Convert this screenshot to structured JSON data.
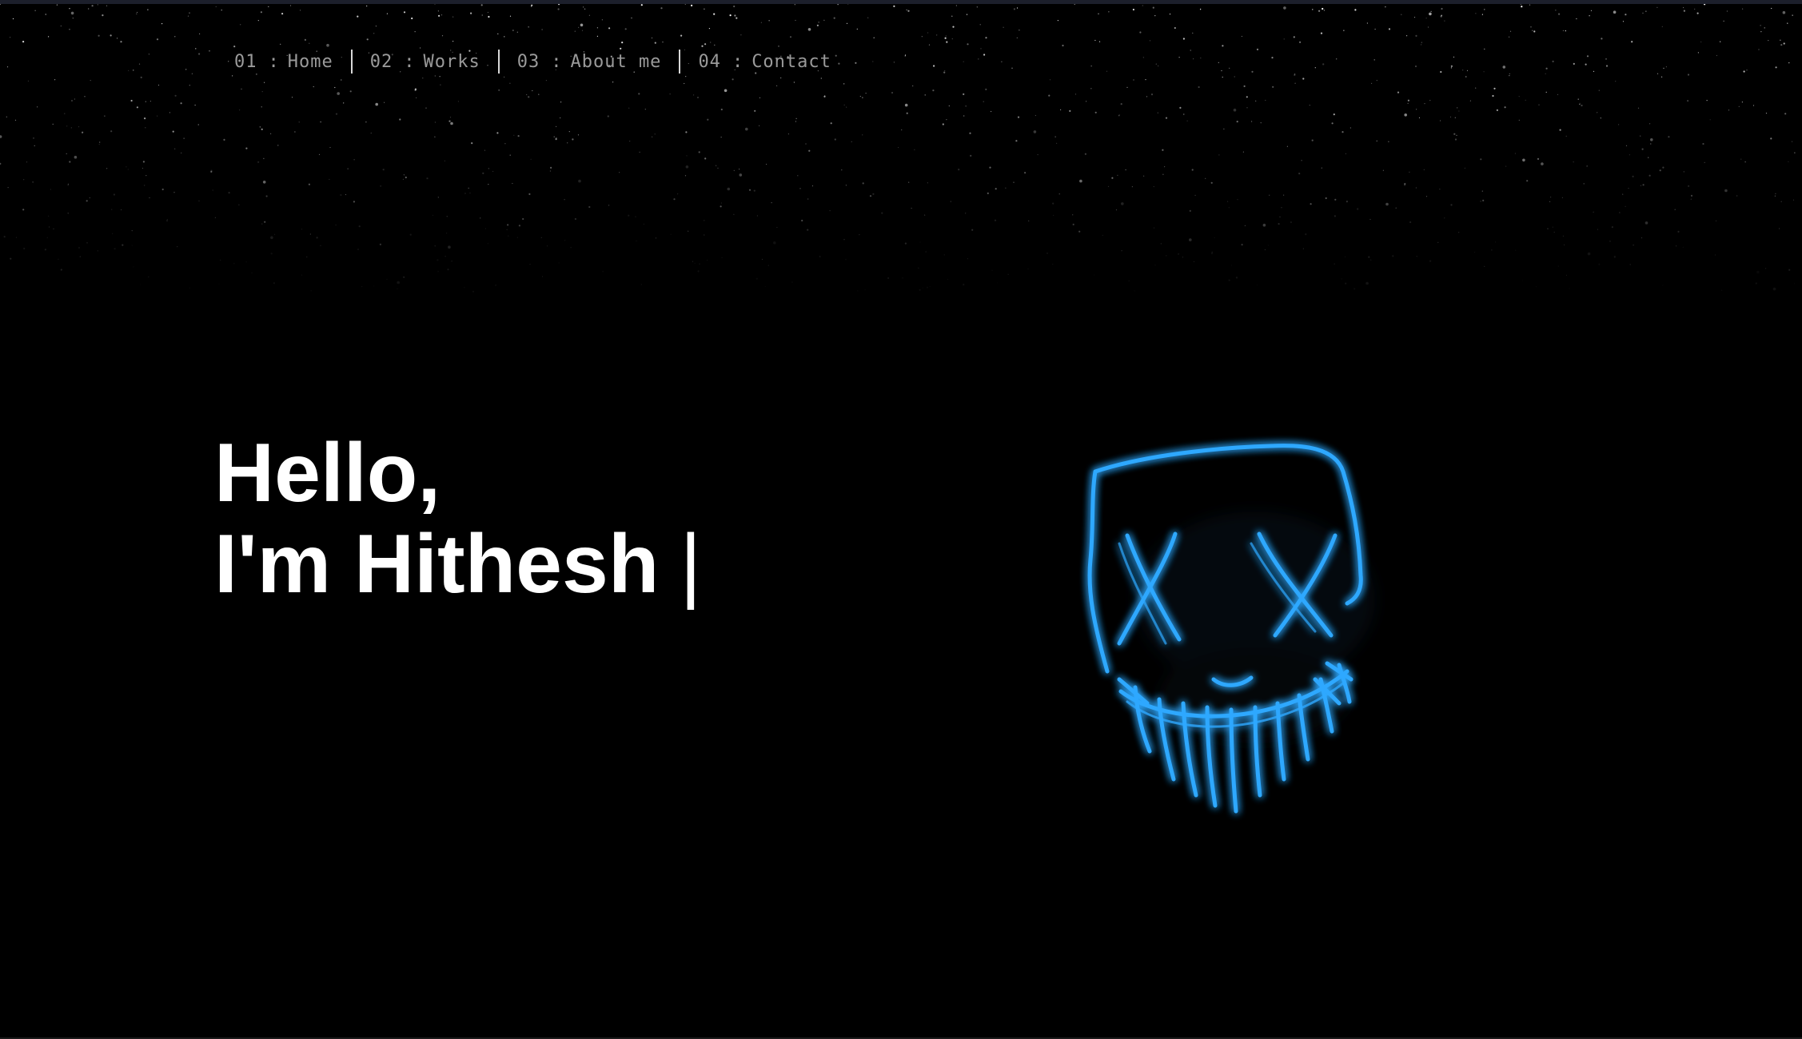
{
  "nav": {
    "items": [
      {
        "number": "01",
        "separator": ":",
        "label": "Home"
      },
      {
        "number": "02",
        "separator": ":",
        "label": "Works"
      },
      {
        "number": "03",
        "separator": ":",
        "label": "About me"
      },
      {
        "number": "04",
        "separator": ":",
        "label": "Contact"
      }
    ]
  },
  "hero": {
    "line1": "Hello,",
    "line2": "I'm Hithesh",
    "cursor": "|"
  },
  "colors": {
    "background": "#000000",
    "text": "#ffffff",
    "nav_text": "#9a9a9a",
    "neon_accent": "#2ea8ff"
  },
  "image": {
    "icon": "neon-mask-icon"
  }
}
